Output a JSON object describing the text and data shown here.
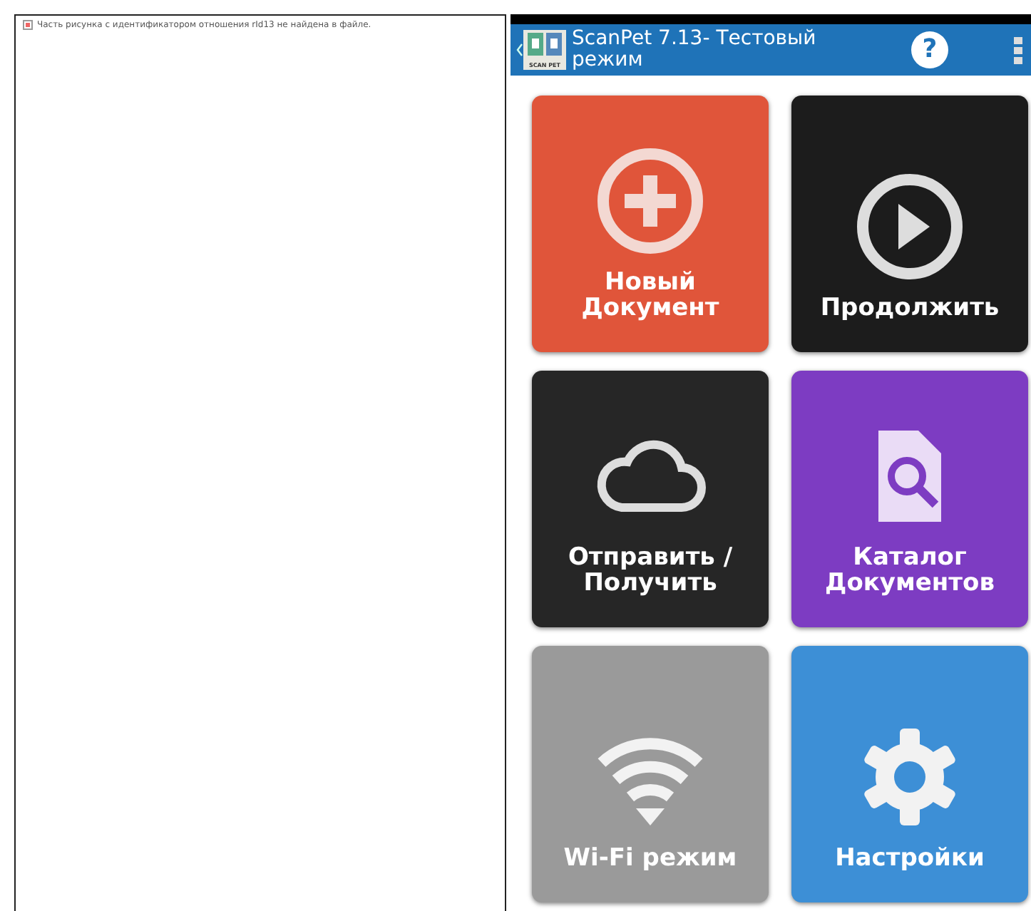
{
  "broken_image": {
    "message": "Часть рисунка с идентификатором отношения rId13 не найдена в файле."
  },
  "app_bar": {
    "title": "ScanPet 7.13- Тестовый режим",
    "logo_text": "SCAN PET",
    "help_glyph": "?"
  },
  "tiles": [
    {
      "label": "Новый Документ",
      "kind": "new",
      "color": "#e0553a"
    },
    {
      "label": "Продолжить",
      "kind": "play",
      "color": "#1c1c1c"
    },
    {
      "label": "Отправить / Получить",
      "kind": "cloud",
      "color": "#262626"
    },
    {
      "label": "Каталог Документов",
      "kind": "catalog",
      "color": "#7d3cc2"
    },
    {
      "label": "Wi-Fi режим",
      "kind": "wifi",
      "color": "#9a9a9a"
    },
    {
      "label": "Настройки",
      "kind": "settings",
      "color": "#3d8fd6"
    }
  ]
}
